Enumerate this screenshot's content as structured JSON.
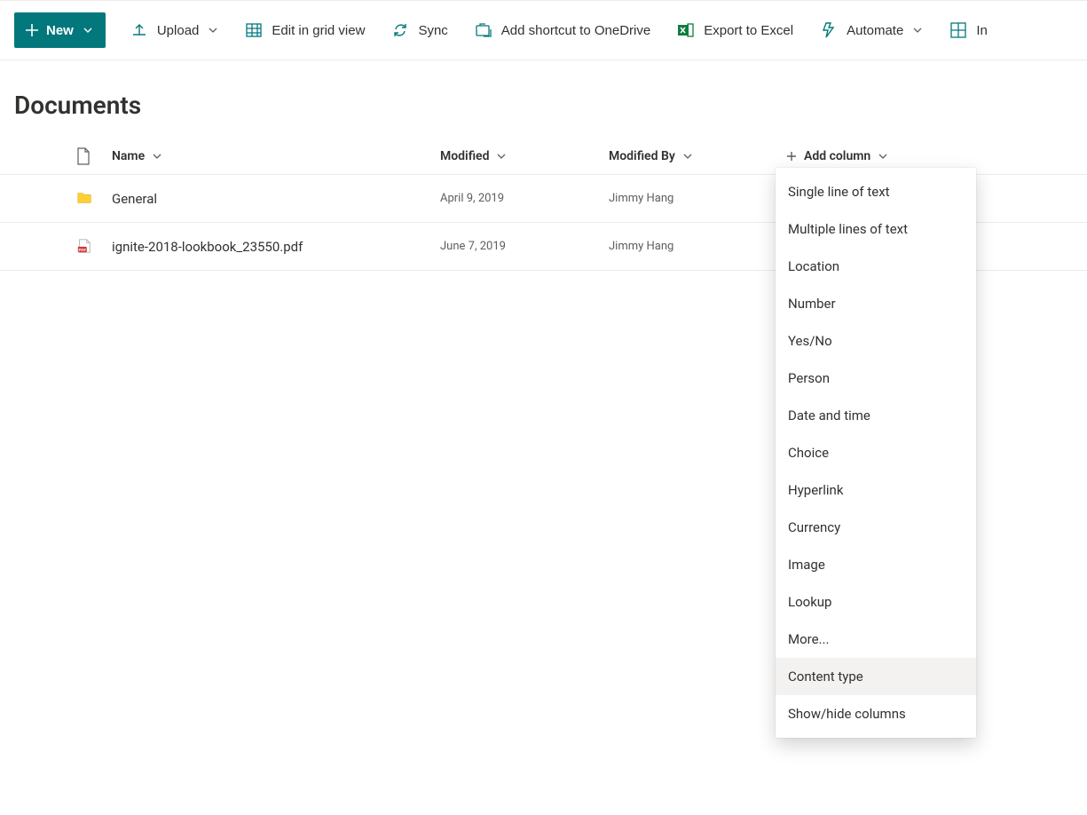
{
  "toolbar": {
    "new_label": "New",
    "upload_label": "Upload",
    "edit_grid_label": "Edit in grid view",
    "sync_label": "Sync",
    "add_shortcut_label": "Add shortcut to OneDrive",
    "export_excel_label": "Export to Excel",
    "automate_label": "Automate",
    "integrate_label": "In"
  },
  "title": "Documents",
  "columns": {
    "name": "Name",
    "modified": "Modified",
    "modified_by": "Modified By",
    "add_column": "Add column"
  },
  "rows": [
    {
      "type": "folder",
      "name": "General",
      "modified": "April 9, 2019",
      "modified_by": "Jimmy Hang"
    },
    {
      "type": "pdf",
      "name": "ignite-2018-lookbook_23550.pdf",
      "modified": "June 7, 2019",
      "modified_by": "Jimmy Hang"
    }
  ],
  "add_column_menu": [
    "Single line of text",
    "Multiple lines of text",
    "Location",
    "Number",
    "Yes/No",
    "Person",
    "Date and time",
    "Choice",
    "Hyperlink",
    "Currency",
    "Image",
    "Lookup",
    "More...",
    "Content type",
    "Show/hide columns"
  ],
  "add_column_menu_hover_index": 13
}
